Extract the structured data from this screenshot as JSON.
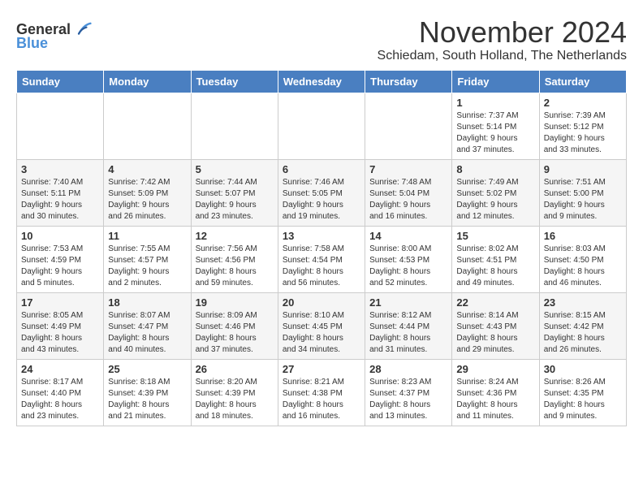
{
  "logo": {
    "general": "General",
    "blue": "Blue"
  },
  "title": "November 2024",
  "subtitle": "Schiedam, South Holland, The Netherlands",
  "headers": [
    "Sunday",
    "Monday",
    "Tuesday",
    "Wednesday",
    "Thursday",
    "Friday",
    "Saturday"
  ],
  "weeks": [
    [
      {
        "day": "",
        "info": ""
      },
      {
        "day": "",
        "info": ""
      },
      {
        "day": "",
        "info": ""
      },
      {
        "day": "",
        "info": ""
      },
      {
        "day": "",
        "info": ""
      },
      {
        "day": "1",
        "info": "Sunrise: 7:37 AM\nSunset: 5:14 PM\nDaylight: 9 hours\nand 37 minutes."
      },
      {
        "day": "2",
        "info": "Sunrise: 7:39 AM\nSunset: 5:12 PM\nDaylight: 9 hours\nand 33 minutes."
      }
    ],
    [
      {
        "day": "3",
        "info": "Sunrise: 7:40 AM\nSunset: 5:11 PM\nDaylight: 9 hours\nand 30 minutes."
      },
      {
        "day": "4",
        "info": "Sunrise: 7:42 AM\nSunset: 5:09 PM\nDaylight: 9 hours\nand 26 minutes."
      },
      {
        "day": "5",
        "info": "Sunrise: 7:44 AM\nSunset: 5:07 PM\nDaylight: 9 hours\nand 23 minutes."
      },
      {
        "day": "6",
        "info": "Sunrise: 7:46 AM\nSunset: 5:05 PM\nDaylight: 9 hours\nand 19 minutes."
      },
      {
        "day": "7",
        "info": "Sunrise: 7:48 AM\nSunset: 5:04 PM\nDaylight: 9 hours\nand 16 minutes."
      },
      {
        "day": "8",
        "info": "Sunrise: 7:49 AM\nSunset: 5:02 PM\nDaylight: 9 hours\nand 12 minutes."
      },
      {
        "day": "9",
        "info": "Sunrise: 7:51 AM\nSunset: 5:00 PM\nDaylight: 9 hours\nand 9 minutes."
      }
    ],
    [
      {
        "day": "10",
        "info": "Sunrise: 7:53 AM\nSunset: 4:59 PM\nDaylight: 9 hours\nand 5 minutes."
      },
      {
        "day": "11",
        "info": "Sunrise: 7:55 AM\nSunset: 4:57 PM\nDaylight: 9 hours\nand 2 minutes."
      },
      {
        "day": "12",
        "info": "Sunrise: 7:56 AM\nSunset: 4:56 PM\nDaylight: 8 hours\nand 59 minutes."
      },
      {
        "day": "13",
        "info": "Sunrise: 7:58 AM\nSunset: 4:54 PM\nDaylight: 8 hours\nand 56 minutes."
      },
      {
        "day": "14",
        "info": "Sunrise: 8:00 AM\nSunset: 4:53 PM\nDaylight: 8 hours\nand 52 minutes."
      },
      {
        "day": "15",
        "info": "Sunrise: 8:02 AM\nSunset: 4:51 PM\nDaylight: 8 hours\nand 49 minutes."
      },
      {
        "day": "16",
        "info": "Sunrise: 8:03 AM\nSunset: 4:50 PM\nDaylight: 8 hours\nand 46 minutes."
      }
    ],
    [
      {
        "day": "17",
        "info": "Sunrise: 8:05 AM\nSunset: 4:49 PM\nDaylight: 8 hours\nand 43 minutes."
      },
      {
        "day": "18",
        "info": "Sunrise: 8:07 AM\nSunset: 4:47 PM\nDaylight: 8 hours\nand 40 minutes."
      },
      {
        "day": "19",
        "info": "Sunrise: 8:09 AM\nSunset: 4:46 PM\nDaylight: 8 hours\nand 37 minutes."
      },
      {
        "day": "20",
        "info": "Sunrise: 8:10 AM\nSunset: 4:45 PM\nDaylight: 8 hours\nand 34 minutes."
      },
      {
        "day": "21",
        "info": "Sunrise: 8:12 AM\nSunset: 4:44 PM\nDaylight: 8 hours\nand 31 minutes."
      },
      {
        "day": "22",
        "info": "Sunrise: 8:14 AM\nSunset: 4:43 PM\nDaylight: 8 hours\nand 29 minutes."
      },
      {
        "day": "23",
        "info": "Sunrise: 8:15 AM\nSunset: 4:42 PM\nDaylight: 8 hours\nand 26 minutes."
      }
    ],
    [
      {
        "day": "24",
        "info": "Sunrise: 8:17 AM\nSunset: 4:40 PM\nDaylight: 8 hours\nand 23 minutes."
      },
      {
        "day": "25",
        "info": "Sunrise: 8:18 AM\nSunset: 4:39 PM\nDaylight: 8 hours\nand 21 minutes."
      },
      {
        "day": "26",
        "info": "Sunrise: 8:20 AM\nSunset: 4:39 PM\nDaylight: 8 hours\nand 18 minutes."
      },
      {
        "day": "27",
        "info": "Sunrise: 8:21 AM\nSunset: 4:38 PM\nDaylight: 8 hours\nand 16 minutes."
      },
      {
        "day": "28",
        "info": "Sunrise: 8:23 AM\nSunset: 4:37 PM\nDaylight: 8 hours\nand 13 minutes."
      },
      {
        "day": "29",
        "info": "Sunrise: 8:24 AM\nSunset: 4:36 PM\nDaylight: 8 hours\nand 11 minutes."
      },
      {
        "day": "30",
        "info": "Sunrise: 8:26 AM\nSunset: 4:35 PM\nDaylight: 8 hours\nand 9 minutes."
      }
    ]
  ]
}
